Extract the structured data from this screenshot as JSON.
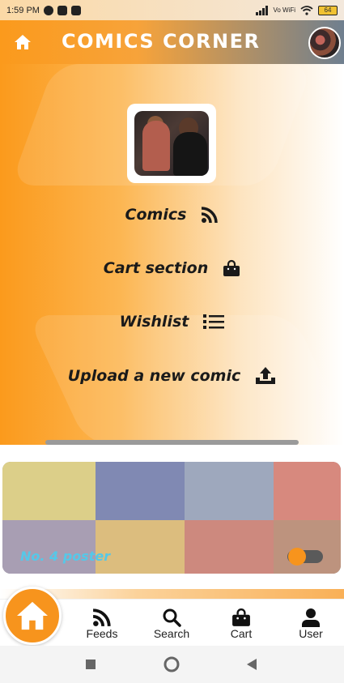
{
  "status_bar": {
    "time": "1:59 PM",
    "volte": "Vo WiFi",
    "battery": "64"
  },
  "header": {
    "title": "Comics Corner",
    "home_icon": "home-icon",
    "avatar": "profile-avatar"
  },
  "menu": {
    "items": [
      {
        "label": "Comics",
        "icon": "rss-icon"
      },
      {
        "label": "Cart section",
        "icon": "shopping-bag-icon"
      },
      {
        "label": "Wishlist",
        "icon": "list-icon"
      },
      {
        "label": "Upload a new comic",
        "icon": "upload-icon"
      }
    ]
  },
  "banner": {
    "label": "No. 4 poster"
  },
  "bottom_nav": {
    "home_icon": "home-icon",
    "items": [
      {
        "label": "Feeds",
        "icon": "rss-icon"
      },
      {
        "label": "Search",
        "icon": "search-icon"
      },
      {
        "label": "Cart",
        "icon": "shopping-bag-icon"
      },
      {
        "label": "User",
        "icon": "user-icon"
      }
    ]
  },
  "colors": {
    "accent": "#f7941d",
    "banner_label": "#55c8e8"
  }
}
